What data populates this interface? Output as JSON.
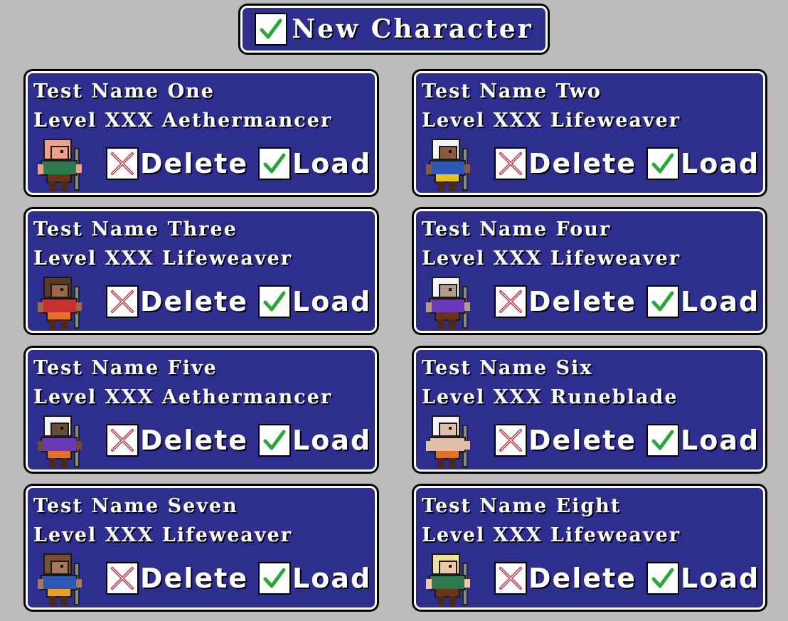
{
  "new_character": {
    "label": "New Character",
    "icon": "check-icon"
  },
  "colors": {
    "background": "#bcbcbc",
    "panel": "#2e2e8e",
    "panel_border": "#ffffff",
    "check": "#2aa836",
    "cross": "#c03040"
  },
  "characters": [
    {
      "name": "Test Name One",
      "level": "Level XXX Aethermancer",
      "delete_label": "Delete",
      "load_label": "Load",
      "hair": "#f0a088",
      "skin": "#f0a088",
      "shirt": "#2e7a4e",
      "pants": "#6a3418"
    },
    {
      "name": "Test Name Two",
      "level": "Level XXX Lifeweaver",
      "delete_label": "Delete",
      "load_label": "Load",
      "hair": "#f4f4f4",
      "skin": "#8a5a3a",
      "shirt": "#2c58b8",
      "pants": "#e8c020"
    },
    {
      "name": "Test Name Three",
      "level": "Level XXX Lifeweaver",
      "delete_label": "Delete",
      "load_label": "Load",
      "hair": "#5a3a22",
      "skin": "#9a6a48",
      "shirt": "#c83030",
      "pants": "#e0702a"
    },
    {
      "name": "Test Name Four",
      "level": "Level XXX Lifeweaver",
      "delete_label": "Delete",
      "load_label": "Load",
      "hair": "#f4f4f4",
      "skin": "#b89888",
      "shirt": "#6a38b8",
      "pants": "#6a3418"
    },
    {
      "name": "Test Name Five",
      "level": "Level XXX Aethermancer",
      "delete_label": "Delete",
      "load_label": "Load",
      "hair": "#f4f4f4",
      "skin": "#6a4a3a",
      "shirt": "#6a38b8",
      "pants": "#e0702a"
    },
    {
      "name": "Test Name Six",
      "level": "Level XXX Runeblade",
      "delete_label": "Delete",
      "load_label": "Load",
      "hair": "#f4f4f4",
      "skin": "#e0c0a8",
      "shirt": "#e0c0a8",
      "pants": "#e0702a"
    },
    {
      "name": "Test Name Seven",
      "level": "Level XXX Lifeweaver",
      "delete_label": "Delete",
      "load_label": "Load",
      "hair": "#7a5030",
      "skin": "#a87858",
      "shirt": "#2c58b8",
      "pants": "#e8a020"
    },
    {
      "name": "Test Name Eight",
      "level": "Level XXX Lifeweaver",
      "delete_label": "Delete",
      "load_label": "Load",
      "hair": "#f0e0a0",
      "skin": "#f0c8a8",
      "shirt": "#2e7a4e",
      "pants": "#6a3418"
    }
  ]
}
